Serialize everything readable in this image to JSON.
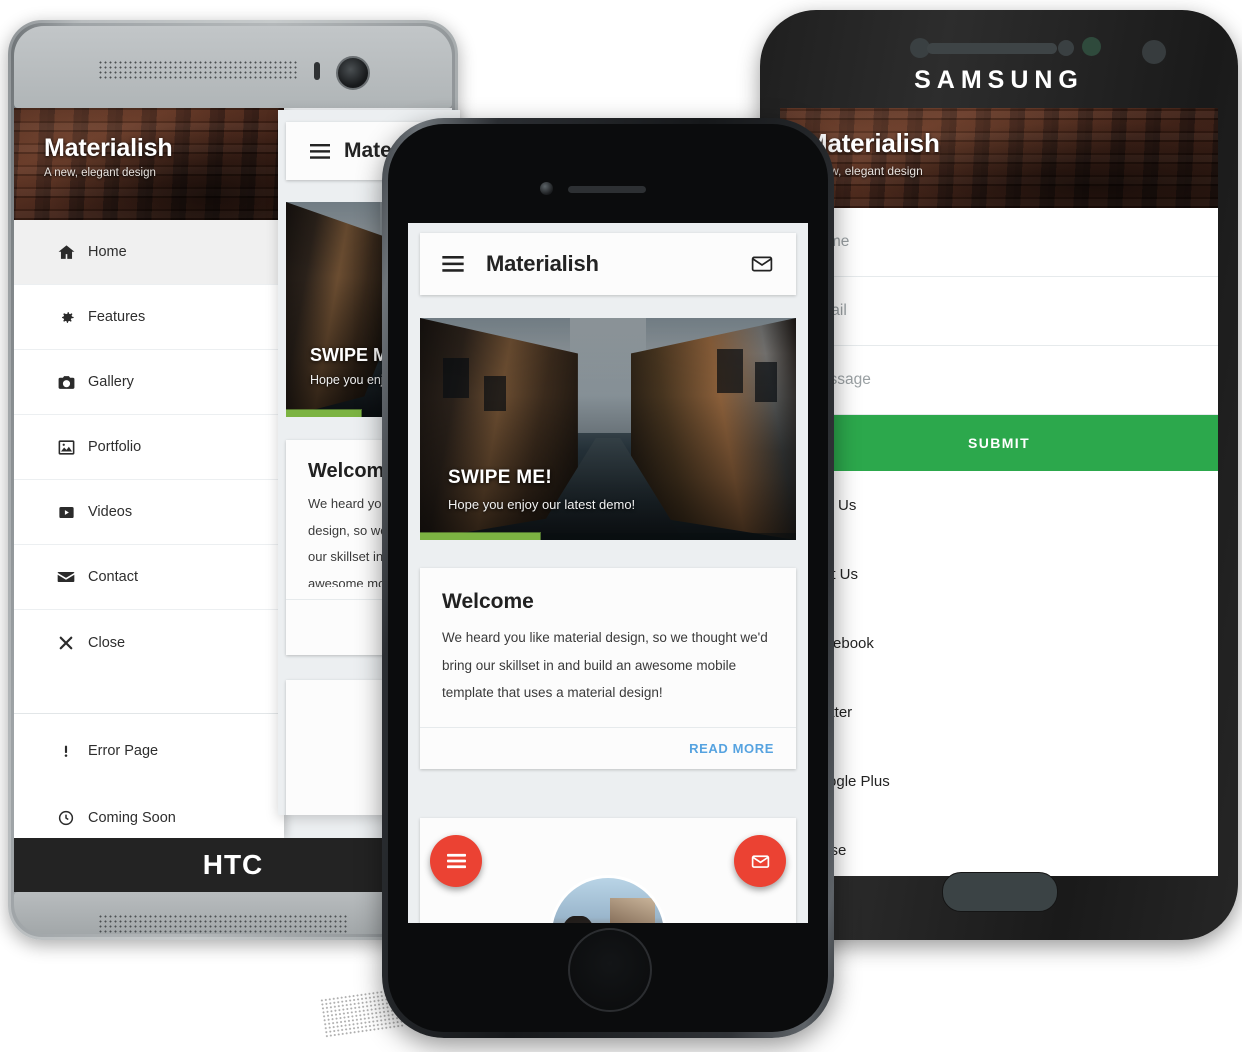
{
  "brand": {
    "title": "Materialish",
    "tagline": "A new, elegant design"
  },
  "devices": {
    "htc": {
      "logo": "HTC"
    },
    "iphone": {
      "logo": ""
    },
    "samsung": {
      "logo": "SAMSUNG"
    }
  },
  "htc_sidebar": {
    "items": [
      {
        "label": "Home",
        "icon": "home-icon"
      },
      {
        "label": "Features",
        "icon": "gear-icon"
      },
      {
        "label": "Gallery",
        "icon": "camera-icon"
      },
      {
        "label": "Portfolio",
        "icon": "image-icon"
      },
      {
        "label": "Videos",
        "icon": "video-icon"
      },
      {
        "label": "Contact",
        "icon": "envelope-icon"
      },
      {
        "label": "Close",
        "icon": "close-icon"
      }
    ],
    "secondary": [
      {
        "label": "Error Page",
        "icon": "exclamation-icon"
      },
      {
        "label": "Coming Soon",
        "icon": "clock-icon"
      }
    ]
  },
  "appbar": {
    "menu_icon": "hamburger-icon",
    "title": "Materialish",
    "mail_icon": "envelope-icon"
  },
  "hero": {
    "heading": "SWIPE ME!",
    "subtext": "Hope you enjoy our latest demo!",
    "progress_percent": 32,
    "progress_color": "#7cb342"
  },
  "welcome_card": {
    "title": "Welcome",
    "body": "We heard you like material design, so we thought we'd bring our skillset in and build an awesome mobile template that uses a material design!",
    "action_label": "READ MORE",
    "action_color": "#56a3e0"
  },
  "contact_form": {
    "fields": [
      {
        "placeholder": "Name"
      },
      {
        "placeholder": "Email"
      },
      {
        "placeholder": "Message"
      }
    ],
    "submit_label": "SUBMIT",
    "submit_color": "#2ca84c"
  },
  "contact_links": [
    {
      "label": "Call Us"
    },
    {
      "label": "Text Us"
    },
    {
      "label": "Facebook"
    },
    {
      "label": "Twitter"
    },
    {
      "label": "Google Plus"
    },
    {
      "label": "Close"
    }
  ],
  "fabs": [
    {
      "name": "menu-fab",
      "icon": "list-icon",
      "color": "#eb4233"
    },
    {
      "name": "mail-fab",
      "icon": "envelope-icon",
      "color": "#eb4233"
    }
  ]
}
